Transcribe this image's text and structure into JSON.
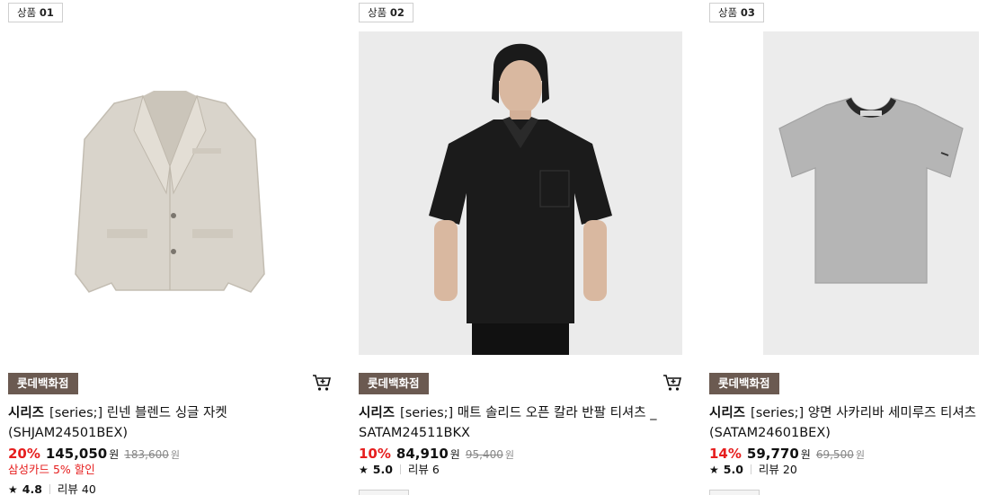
{
  "products": [
    {
      "rank_label": "상품",
      "rank_num": "01",
      "badge": "롯데백화점",
      "brand": "시리즈",
      "title": "[series;] 린넨 블렌드 싱글 자켓 (SHJAM24501BEX)",
      "discount_rate": "20%",
      "price": "145,050",
      "currency": "원",
      "original_price": "183,600",
      "promo": "삼성카드 5% 할인",
      "rating": "4.8",
      "review_label": "리뷰 40",
      "image_icon": "linen-jacket-image",
      "product_color": "#d9d4cb"
    },
    {
      "rank_label": "상품",
      "rank_num": "02",
      "badge": "롯데백화점",
      "brand": "시리즈",
      "title": "[series;] 매트 솔리드 오픈 칼라 반팔 티셔츠 _ SATAM24511BKX",
      "discount_rate": "10%",
      "price": "84,910",
      "currency": "원",
      "original_price": "95,400",
      "promo": "",
      "rating": "5.0",
      "review_label": "리뷰 6",
      "image_icon": "model-black-shirt-image",
      "product_color": "#1b1b1b"
    },
    {
      "rank_label": "상품",
      "rank_num": "03",
      "badge": "롯데백화점",
      "brand": "시리즈",
      "title": "[series;] 양면 사카리바 세미루즈 티셔츠 (SATAM24601BEX)",
      "discount_rate": "14%",
      "price": "59,770",
      "currency": "원",
      "original_price": "69,500",
      "promo": "",
      "rating": "5.0",
      "review_label": "리뷰 20",
      "image_icon": "gray-tshirt-image",
      "product_color": "#b5b5b5"
    }
  ],
  "colors": {
    "discount": "#e61e1e",
    "badge_bg": "#6b5a51"
  },
  "icons": {
    "cart": "cart-icon",
    "star": "star-icon"
  }
}
